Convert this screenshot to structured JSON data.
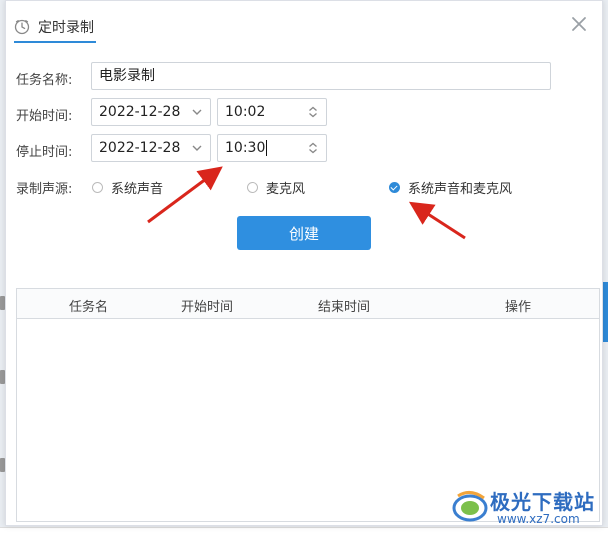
{
  "dialog": {
    "tab_title": "定时录制",
    "close_label": "×"
  },
  "form": {
    "task_name_label": "任务名称:",
    "task_name_value": "电影录制",
    "start_label": "开始时间:",
    "start_date": "2022-12-28",
    "start_time": "10:02",
    "stop_label": "停止时间:",
    "stop_date": "2022-12-28",
    "stop_time": "10:30",
    "source_label": "录制声源:",
    "sources": [
      {
        "label": "系统声音",
        "checked": false
      },
      {
        "label": "麦克风",
        "checked": false
      },
      {
        "label": "系统声音和麦克风",
        "checked": true
      }
    ],
    "create_button": "创建"
  },
  "table": {
    "columns": [
      "任务名",
      "开始时间",
      "结束时间",
      "操作"
    ]
  },
  "watermark": {
    "title": "极光下载站",
    "url": "www.xz7.com"
  },
  "colors": {
    "accent": "#2f8fe0",
    "arrow": "#d9261c"
  }
}
